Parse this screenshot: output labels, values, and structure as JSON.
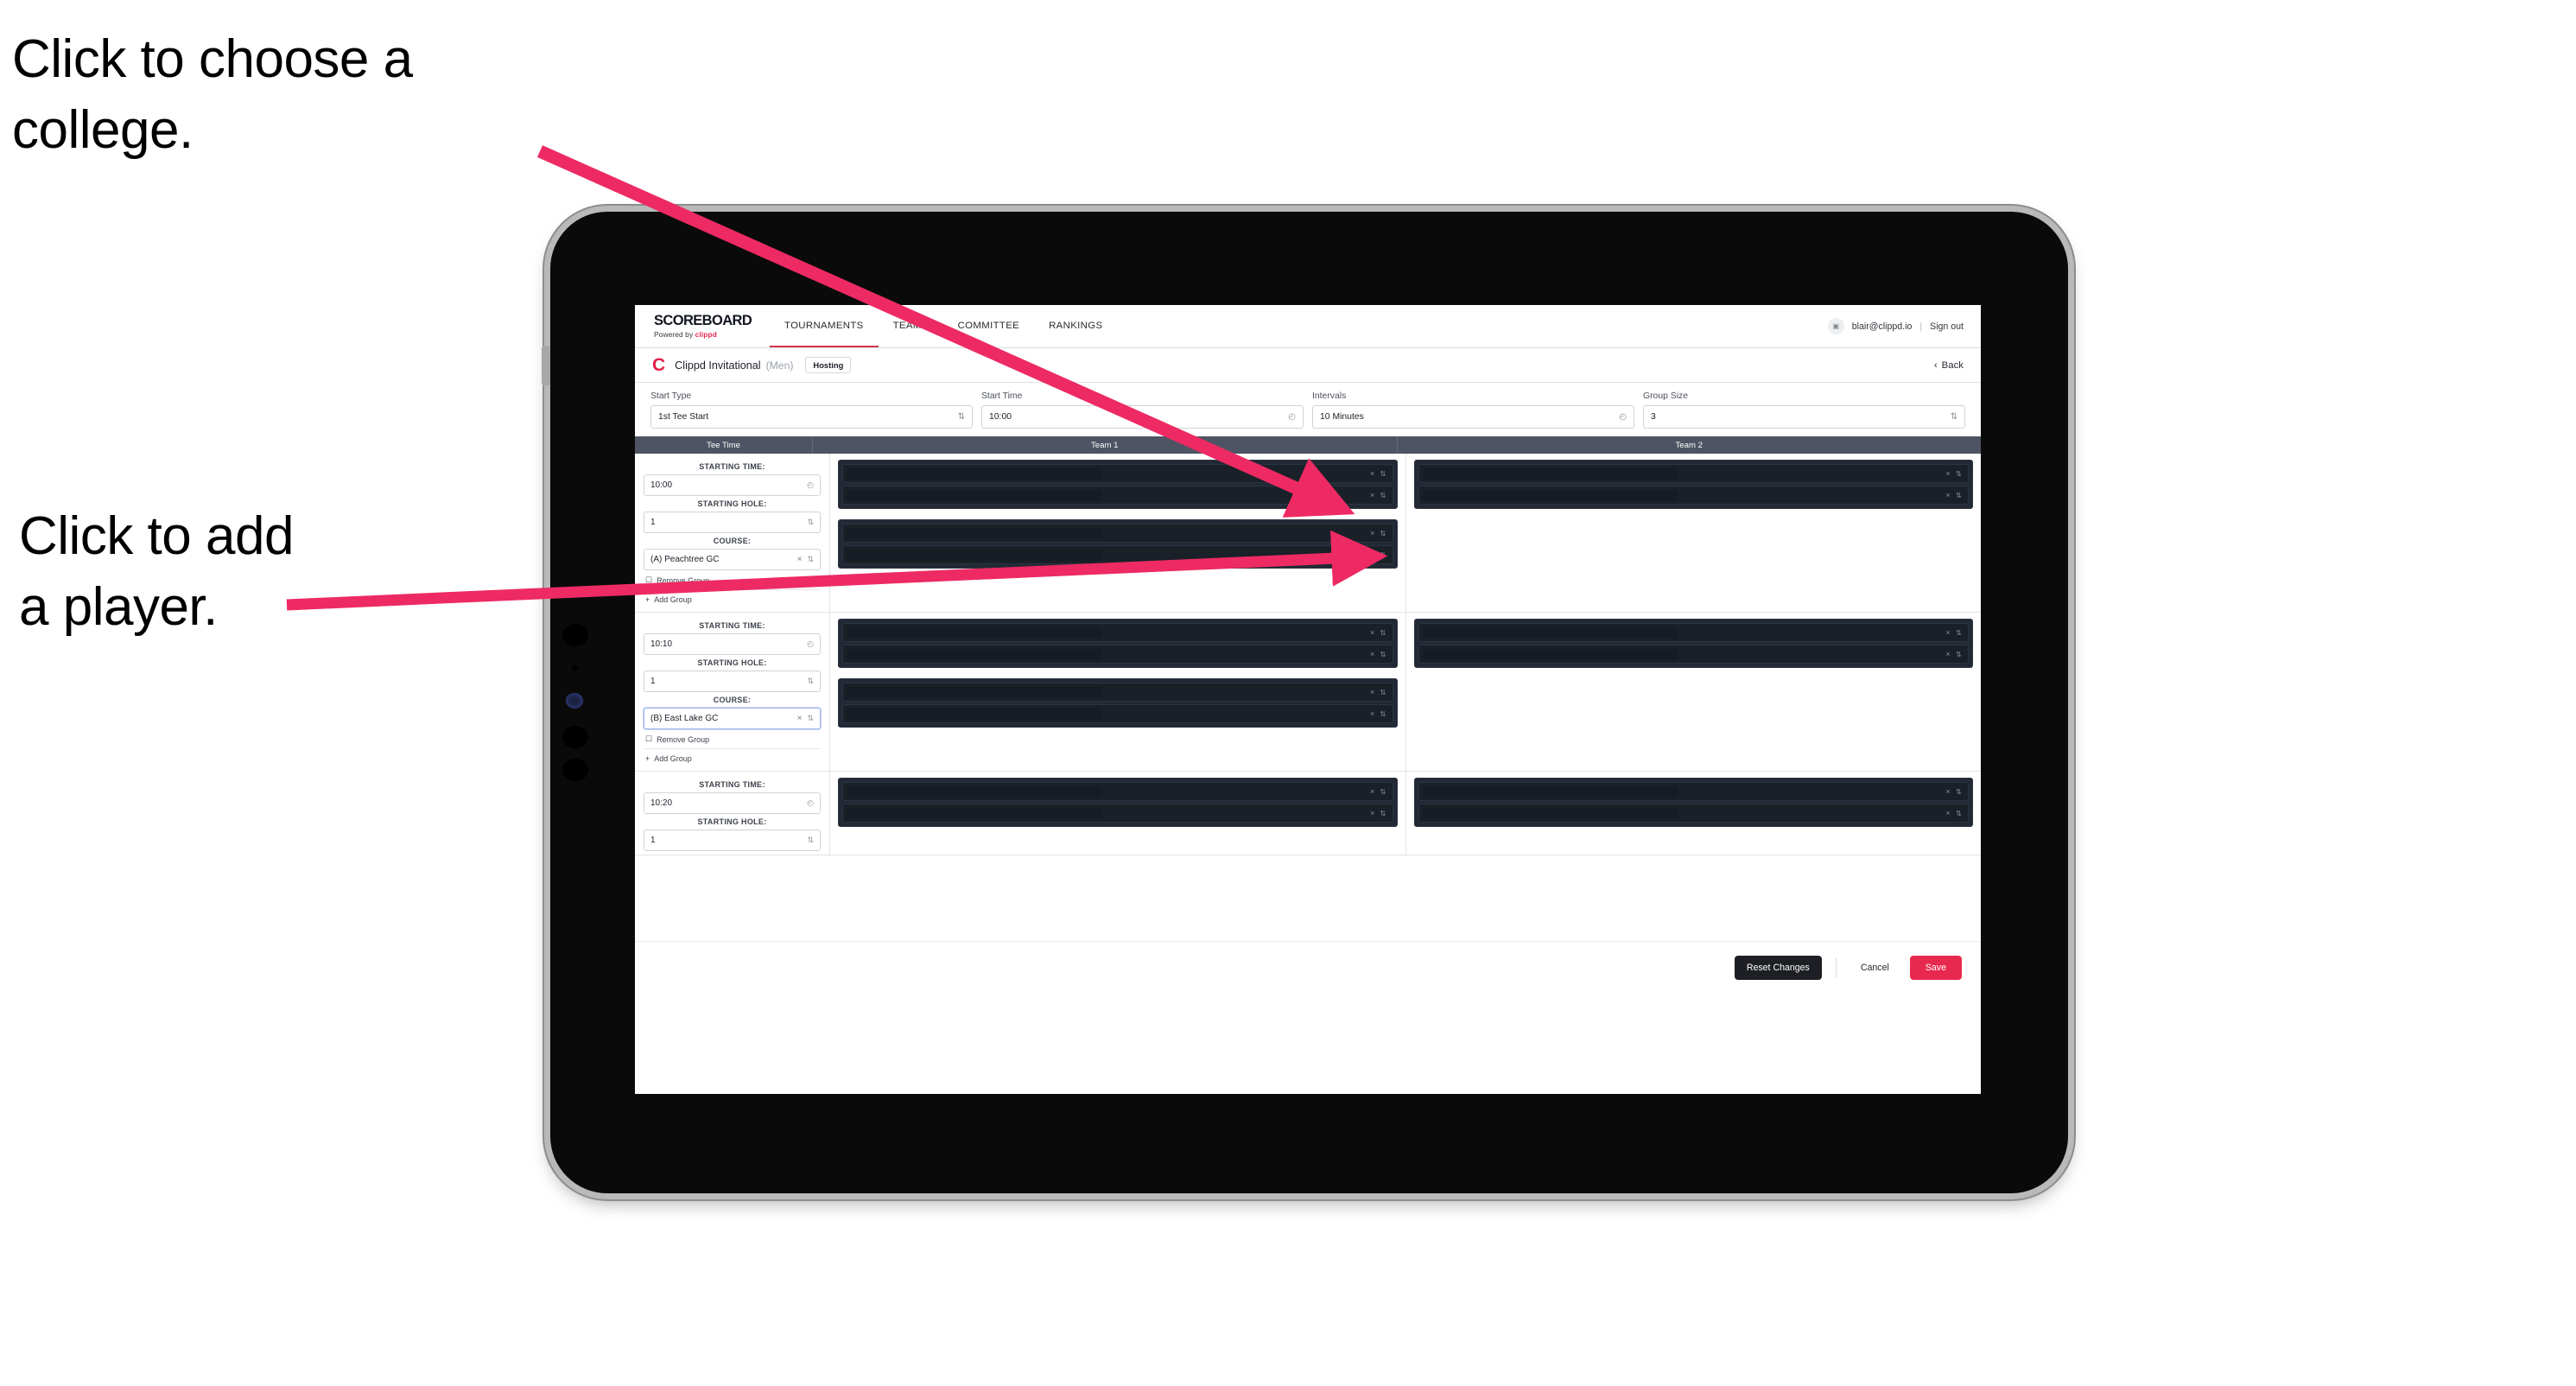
{
  "annotations": {
    "college": "Click to choose a\ncollege.",
    "player": "Click to add\na player.",
    "arrow_color": "#ed2a63"
  },
  "nav": {
    "brand_title": "SCOREBOARD",
    "brand_sub_prefix": "Powered by ",
    "brand_sub_name": "clippd",
    "tabs": [
      {
        "label": "TOURNAMENTS",
        "active": true
      },
      {
        "label": "TEAMS",
        "active": false
      },
      {
        "label": "COMMITTEE",
        "active": false
      },
      {
        "label": "RANKINGS",
        "active": false
      }
    ],
    "account_email": "blair@clippd.io",
    "separator": "|",
    "sign_out": "Sign out",
    "avatar_glyph": "▣"
  },
  "tournament": {
    "logo_letter": "C",
    "name": "Clippd Invitational",
    "gender": "(Men)",
    "status_badge": "Hosting",
    "back_label": "Back",
    "back_chevron": "‹"
  },
  "form": {
    "fields": [
      {
        "label": "Start Type",
        "value": "1st Tee Start",
        "icon": "⇅"
      },
      {
        "label": "Start Time",
        "value": "10:00",
        "icon": "◴"
      },
      {
        "label": "Intervals",
        "value": "10 Minutes",
        "icon": "◴"
      },
      {
        "label": "Group Size",
        "value": "3",
        "icon": "⇅"
      }
    ]
  },
  "table": {
    "headers": [
      "Tee Time",
      "Team 1",
      "Team 2"
    ],
    "labels": {
      "starting_time": "STARTING TIME:",
      "starting_hole": "STARTING HOLE:",
      "course": "COURSE:",
      "remove_group": "Remove Group",
      "add_group": "Add Group",
      "trash_icon": "☐",
      "plus_icon": "+",
      "clock_icon": "◴",
      "stepper_icon": "⇅",
      "clear_icon": "×"
    },
    "groups": [
      {
        "starting_time": "10:00",
        "starting_hole": "1",
        "course": "(A) Peachtree GC",
        "course_focused": false,
        "team1": [
          {
            "rows": 2
          },
          {
            "rows": 2
          }
        ],
        "team2": [
          {
            "rows": 2
          }
        ]
      },
      {
        "starting_time": "10:10",
        "starting_hole": "1",
        "course": "(B) East Lake GC",
        "course_focused": true,
        "team1": [
          {
            "rows": 2
          },
          {
            "rows": 2
          }
        ],
        "team2": [
          {
            "rows": 2
          }
        ]
      },
      {
        "starting_time": "10:20",
        "starting_hole": "1",
        "course": "",
        "course_focused": false,
        "team1": [
          {
            "rows": 2
          }
        ],
        "team2": [
          {
            "rows": 2
          }
        ]
      }
    ]
  },
  "footer": {
    "reset_label": "Reset Changes",
    "cancel_label": "Cancel",
    "save_label": "Save"
  },
  "colors": {
    "accent_pink": "#e8294f",
    "table_header": "#4e5463",
    "dark_row": "#1a2028"
  }
}
